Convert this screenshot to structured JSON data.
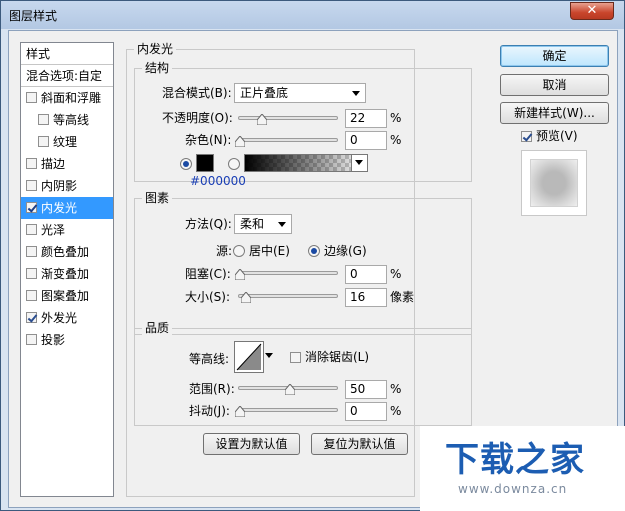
{
  "window": {
    "title": "图层样式",
    "close_glyph": "✕"
  },
  "left_panel": {
    "header": "样式",
    "blend_options": "混合选项:自定",
    "items": [
      {
        "label": "斜面和浮雕",
        "checked": false
      },
      {
        "label": "等高线",
        "checked": false
      },
      {
        "label": "纹理",
        "checked": false
      },
      {
        "label": "描边",
        "checked": false
      },
      {
        "label": "内阴影",
        "checked": false
      },
      {
        "label": "内发光",
        "checked": true,
        "selected": true
      },
      {
        "label": "光泽",
        "checked": false
      },
      {
        "label": "颜色叠加",
        "checked": false
      },
      {
        "label": "渐变叠加",
        "checked": false
      },
      {
        "label": "图案叠加",
        "checked": false
      },
      {
        "label": "外发光",
        "checked": true
      },
      {
        "label": "投影",
        "checked": false
      }
    ]
  },
  "panel": {
    "title": "内发光",
    "structure": {
      "title": "结构",
      "blend_mode_label": "混合模式(B):",
      "blend_mode_value": "正片叠底",
      "opacity_label": "不透明度(O):",
      "opacity_value": "22",
      "opacity_fraction": 0.22,
      "noise_label": "杂色(N):",
      "noise_value": "0",
      "noise_fraction": 0,
      "percent": "%",
      "color_hex": "#000000",
      "color_swatch": "#000000"
    },
    "elements": {
      "title": "图素",
      "method_label": "方法(Q):",
      "method_value": "柔和",
      "source_label": "源:",
      "source_center": "居中(E)",
      "source_edge": "边缘(G)",
      "choke_label": "阻塞(C):",
      "choke_value": "0",
      "choke_fraction": 0,
      "size_label": "大小(S):",
      "size_value": "16",
      "size_fraction": 0.064,
      "size_unit": "像素"
    },
    "quality": {
      "title": "品质",
      "contour_label": "等高线:",
      "anti_alias_label": "消除锯齿(L)",
      "range_label": "范围(R):",
      "range_value": "50",
      "range_fraction": 0.5,
      "jitter_label": "抖动(J):",
      "jitter_value": "0",
      "jitter_fraction": 0
    },
    "set_default": "设置为默认值",
    "reset_default": "复位为默认值"
  },
  "right": {
    "ok": "确定",
    "cancel": "取消",
    "new_style": "新建样式(W)...",
    "preview_label": "预览(V)",
    "preview_checked": true
  },
  "watermark": {
    "logo": "下载之家",
    "url": "www.downza.cn"
  }
}
